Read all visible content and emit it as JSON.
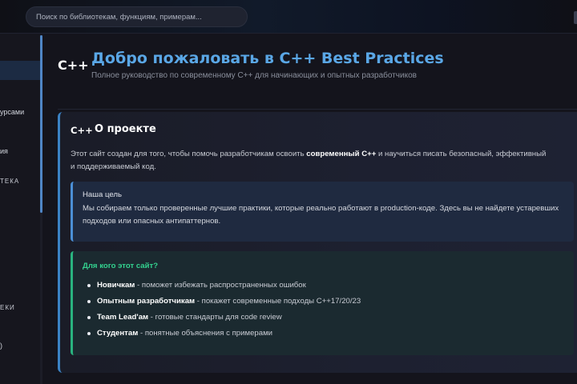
{
  "search": {
    "placeholder": "Поиск по библиотекам, функциям, примерам..."
  },
  "sidebar": {
    "items": [
      {
        "label": "урсами"
      },
      {
        "label": "ия"
      },
      {
        "label": "ТЕКА"
      },
      {
        "label": "ЕКИ"
      },
      {
        "label": ")"
      }
    ]
  },
  "header": {
    "logo": "C++",
    "title": "Добро пожаловать в C++ Best Practices",
    "subtitle": "Полное руководство по современному C++ для начинающих и опытных разработчиков"
  },
  "about": {
    "icon": "C++",
    "title": "О проекте",
    "intro_before": "Этот сайт создан для того, чтобы помочь разработчикам освоить ",
    "intro_bold": "современный C++",
    "intro_after": " и научиться писать безопасный, эффективный и поддерживаемый код.",
    "goal": {
      "title": "Наша цель",
      "text": "Мы собираем только проверенные лучшие практики, которые реально работают в production-коде. Здесь вы не найдете устаревших подходов или опасных антипаттернов."
    },
    "audience": {
      "title": "Для кого этот сайт?",
      "items": [
        {
          "bold": "Новичкам",
          "text": " - поможет избежать распространенных ошибок"
        },
        {
          "bold": "Опытным разработчикам",
          "text": " - покажет современные подходы C++17/20/23"
        },
        {
          "bold": "Team Lead'ам",
          "text": " - готовые стандарты для code review"
        },
        {
          "bold": "Студентам",
          "text": " - понятные объяснения с примерами"
        }
      ]
    }
  },
  "colors": {
    "accent": "#5aa7e6",
    "goal_border": "#4b8fd6",
    "audience_accent": "#33d28f"
  }
}
